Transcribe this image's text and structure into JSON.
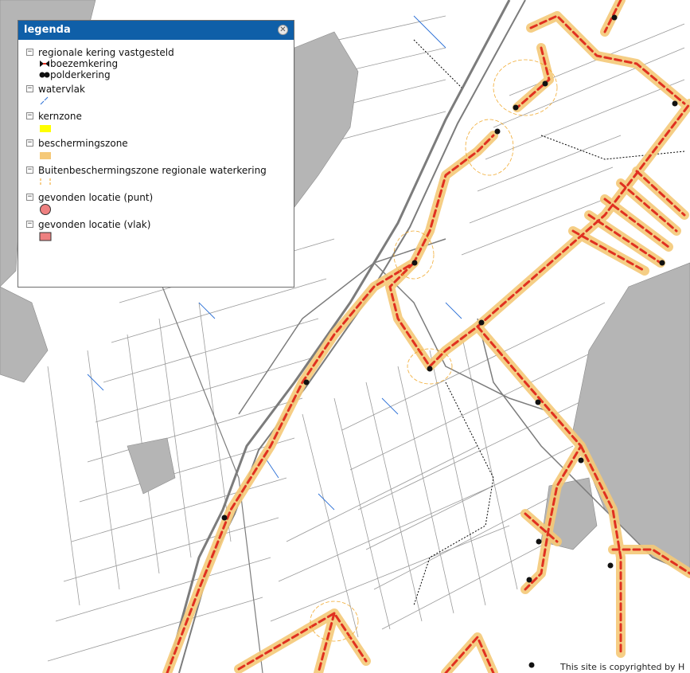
{
  "legend": {
    "title": "legenda",
    "close_icon": "close-icon",
    "groups": [
      {
        "label": "regionale kering vastgesteld",
        "subitems": [
          {
            "label": "boezemkering",
            "icon": "boezemkering-symbol"
          },
          {
            "label": "polderkering",
            "icon": "polderkering-symbol"
          }
        ]
      },
      {
        "label": "watervlak",
        "icon": "watervlak-swatch"
      },
      {
        "label": "kernzone",
        "icon": "kernzone-swatch",
        "color": "#ffff00"
      },
      {
        "label": "beschermingszone",
        "icon": "beschermingszone-swatch",
        "color": "#f5c978"
      },
      {
        "label": "Buitenbeschermingszone regionale waterkering",
        "icon": "buitenbeschermingszone-swatch",
        "color": "#f0a21c"
      },
      {
        "label": "gevonden locatie (punt)",
        "icon": "punt-swatch",
        "color": "#ee8080"
      },
      {
        "label": "gevonden locatie (vlak)",
        "icon": "vlak-swatch",
        "color": "#ee8080"
      }
    ]
  },
  "copyright": "This site is copyrighted by H",
  "colors": {
    "header": "#0f5fa8",
    "basemap_lines": "#8c8c8c",
    "water_lines": "#2a6fd6",
    "kering_line": "#e03020",
    "kernzone": "#ffff00",
    "beschermingszone": "#f5c978"
  }
}
